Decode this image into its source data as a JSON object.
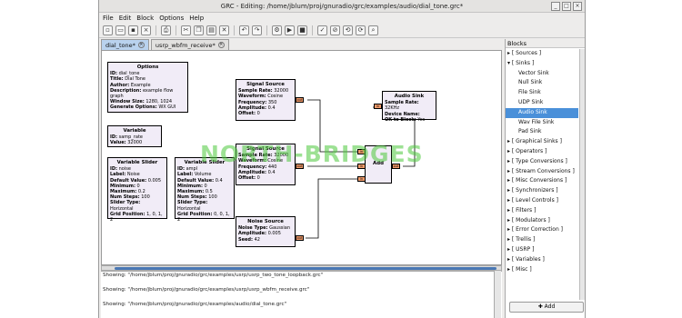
{
  "window": {
    "title": "GRC - Editing: /home/jblum/proj/gnuradio/grc/examples/audio/dial_tone.grc*"
  },
  "menu": [
    "File",
    "Edit",
    "Block",
    "Options",
    "Help"
  ],
  "tabs": [
    {
      "label": "dial_tone*"
    },
    {
      "label": "usrp_wbfm_receive*"
    }
  ],
  "blocks": {
    "options": {
      "title": "Options",
      "params": [
        [
          "ID:",
          "dial_tone"
        ],
        [
          "Title:",
          "Dial Tone"
        ],
        [
          "Author:",
          "Example"
        ],
        [
          "Description:",
          "example flow graph"
        ],
        [
          "Window Size:",
          "1280, 1024"
        ],
        [
          "Generate Options:",
          "WX GUI"
        ]
      ]
    },
    "variable": {
      "title": "Variable",
      "params": [
        [
          "ID:",
          "samp_rate"
        ],
        [
          "Value:",
          "32000"
        ]
      ]
    },
    "slider1": {
      "title": "Variable Slider",
      "params": [
        [
          "ID:",
          "noise"
        ],
        [
          "Label:",
          "Noise"
        ],
        [
          "Default Value:",
          "0.005"
        ],
        [
          "Minimum:",
          "0"
        ],
        [
          "Maximum:",
          "0.2"
        ],
        [
          "Num Steps:",
          "100"
        ],
        [
          "Slider Type:",
          "Horizontal"
        ],
        [
          "Grid Position:",
          "1, 0, 1, 2"
        ]
      ]
    },
    "slider2": {
      "title": "Variable Slider",
      "params": [
        [
          "ID:",
          "ampl"
        ],
        [
          "Label:",
          "Volume"
        ],
        [
          "Default Value:",
          "0.4"
        ],
        [
          "Minimum:",
          "0"
        ],
        [
          "Maximum:",
          "0.5"
        ],
        [
          "Num Steps:",
          "100"
        ],
        [
          "Slider Type:",
          "Horizontal"
        ],
        [
          "Grid Position:",
          "0, 0, 1, 2"
        ]
      ]
    },
    "sig1": {
      "title": "Signal Source",
      "params": [
        [
          "Sample Rate:",
          "32000"
        ],
        [
          "Waveform:",
          "Cosine"
        ],
        [
          "Frequency:",
          "350"
        ],
        [
          "Amplitude:",
          "0.4"
        ],
        [
          "Offset:",
          "0"
        ]
      ]
    },
    "sig2": {
      "title": "Signal Source",
      "params": [
        [
          "Sample Rate:",
          "32000"
        ],
        [
          "Waveform:",
          "Cosine"
        ],
        [
          "Frequency:",
          "440"
        ],
        [
          "Amplitude:",
          "0.4"
        ],
        [
          "Offset:",
          "0"
        ]
      ]
    },
    "noise": {
      "title": "Noise Source",
      "params": [
        [
          "Noise Type:",
          "Gaussian"
        ],
        [
          "Amplitude:",
          "0.005"
        ],
        [
          "Seed:",
          "42"
        ]
      ]
    },
    "add": {
      "title": "Add"
    },
    "sink": {
      "title": "Audio Sink",
      "params": [
        [
          "Sample Rate:",
          "32KHz"
        ],
        [
          "Device Name:",
          ""
        ],
        [
          "OK to Block:",
          "Yes"
        ]
      ]
    }
  },
  "ports": {
    "out": "out",
    "in": "in"
  },
  "console": [
    "Showing: \"/home/jblum/proj/gnuradio/grc/examples/usrp/usrp_two_tone_loopback.grc\"",
    "Showing: \"/home/jblum/proj/gnuradio/grc/examples/usrp/usrp_wbfm_receive.grc\"",
    "Showing: \"/home/jblum/proj/gnuradio/grc/examples/audio/dial_tone.grc\""
  ],
  "panel": {
    "header": "Blocks",
    "items": [
      {
        "label": "[ Sources ]",
        "indent": 0,
        "arrow": "▸"
      },
      {
        "label": "[ Sinks ]",
        "indent": 0,
        "arrow": "▾"
      },
      {
        "label": "Vector Sink",
        "indent": 1,
        "arrow": ""
      },
      {
        "label": "Null Sink",
        "indent": 1,
        "arrow": ""
      },
      {
        "label": "File Sink",
        "indent": 1,
        "arrow": ""
      },
      {
        "label": "UDP Sink",
        "indent": 1,
        "arrow": ""
      },
      {
        "label": "Audio Sink",
        "indent": 1,
        "arrow": "",
        "selected": true
      },
      {
        "label": "Wav File Sink",
        "indent": 1,
        "arrow": ""
      },
      {
        "label": "Pad Sink",
        "indent": 1,
        "arrow": ""
      },
      {
        "label": "[ Graphical Sinks ]",
        "indent": 0,
        "arrow": "▸"
      },
      {
        "label": "[ Operators ]",
        "indent": 0,
        "arrow": "▸"
      },
      {
        "label": "[ Type Conversions ]",
        "indent": 0,
        "arrow": "▸"
      },
      {
        "label": "[ Stream Conversions ]",
        "indent": 0,
        "arrow": "▸"
      },
      {
        "label": "[ Misc Conversions ]",
        "indent": 0,
        "arrow": "▸"
      },
      {
        "label": "[ Synchronizers ]",
        "indent": 0,
        "arrow": "▸"
      },
      {
        "label": "[ Level Controls ]",
        "indent": 0,
        "arrow": "▸"
      },
      {
        "label": "[ Filters ]",
        "indent": 0,
        "arrow": "▸"
      },
      {
        "label": "[ Modulators ]",
        "indent": 0,
        "arrow": "▸"
      },
      {
        "label": "[ Error Correction ]",
        "indent": 0,
        "arrow": "▸"
      },
      {
        "label": "[ Trellis ]",
        "indent": 0,
        "arrow": "▸"
      },
      {
        "label": "[ USRP ]",
        "indent": 0,
        "arrow": "▸"
      },
      {
        "label": "[ Variables ]",
        "indent": 0,
        "arrow": "▸"
      },
      {
        "label": "[ Misc ]",
        "indent": 0,
        "arrow": "▸"
      }
    ],
    "add_label": "Add"
  },
  "watermark": "NORTH-BRIDGES",
  "colors": {
    "accent": "#4a90d9",
    "block_bg": "#f1ecf7",
    "port": "#f09a6a"
  }
}
